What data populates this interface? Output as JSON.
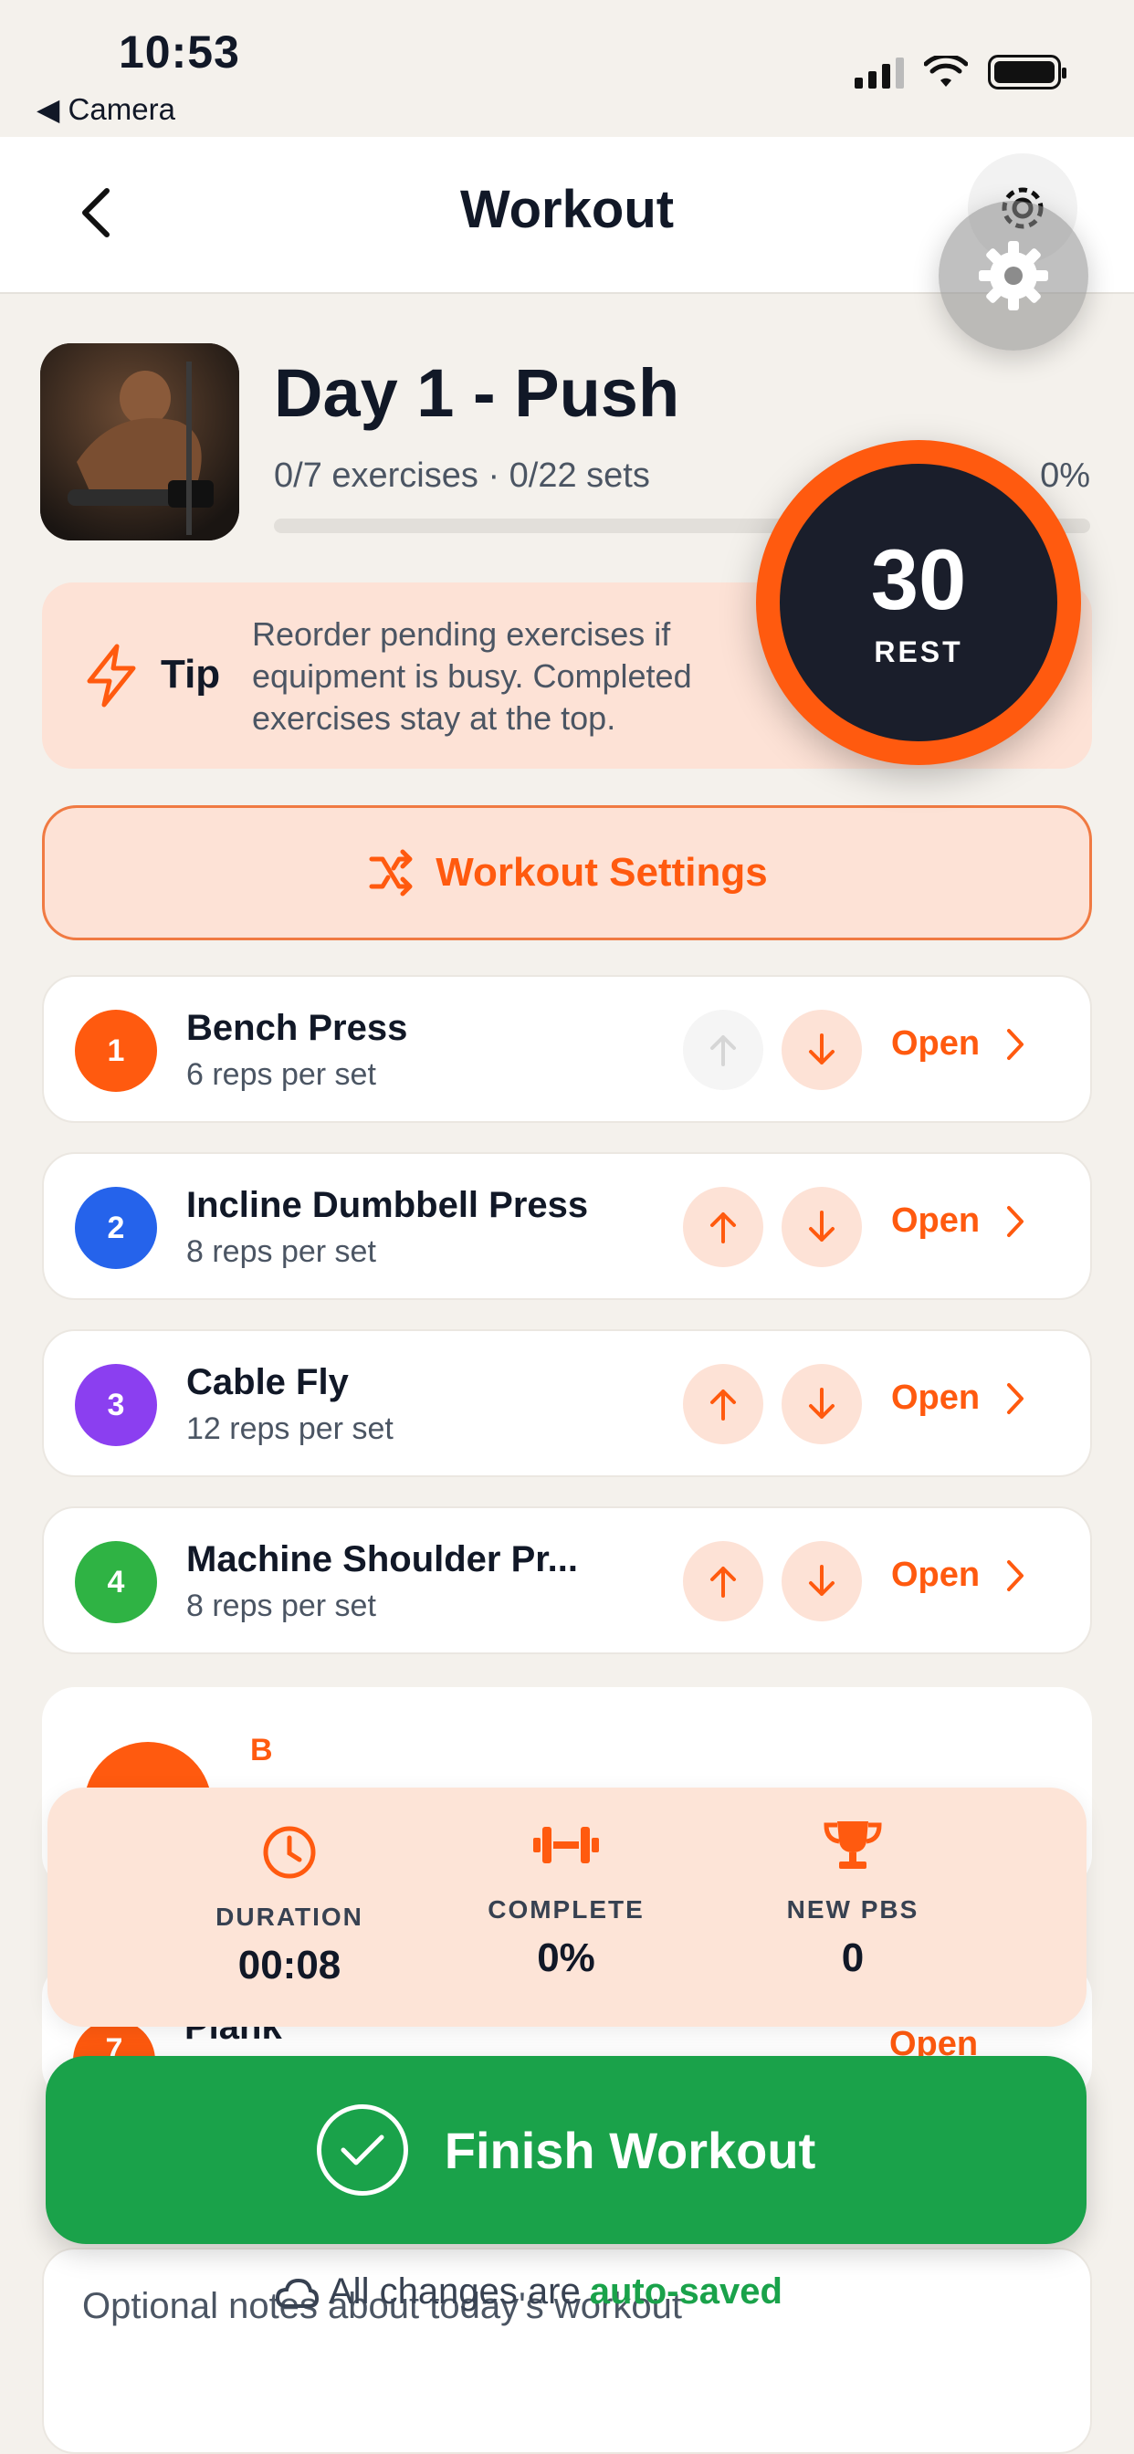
{
  "status_bar": {
    "time": "10:53",
    "back_app": "◀ Camera"
  },
  "nav": {
    "title": "Workout",
    "back_icon": "chevron-left-icon",
    "settings_icon": "gear-icon"
  },
  "workout": {
    "title": "Day 1 - Push",
    "meta": "0/7 exercises · 0/22 sets",
    "progress_pct": "0%",
    "progress_value": 0
  },
  "rest_timer": {
    "seconds": "30",
    "label": "REST"
  },
  "tip": {
    "label": "Tip",
    "text": "Reorder pending exercises if equipment is busy. Completed exercises stay at the top."
  },
  "settings_button": {
    "label": "Workout Settings",
    "icon": "shuffle-icon"
  },
  "exercises": [
    {
      "number": "1",
      "name": "Bench Press",
      "sub": "6 reps per set",
      "open": "Open",
      "color": "#ff5a0f"
    },
    {
      "number": "2",
      "name": "Incline Dumbbell Press",
      "sub": "8 reps per set",
      "open": "Open",
      "color": "#2563eb"
    },
    {
      "number": "3",
      "name": "Cable Fly",
      "sub": "12 reps per set",
      "open": "Open",
      "color": "#8b3ff0"
    },
    {
      "number": "4",
      "name": "Machine Shoulder Pr...",
      "sub": "8 reps per set",
      "open": "Open",
      "color": "#2fb344"
    }
  ],
  "hidden_card": {
    "letter": "B"
  },
  "stats": [
    {
      "label": "DURATION",
      "value": "00:08",
      "icon": "clock-icon"
    },
    {
      "label": "COMPLETE",
      "value": "0%",
      "icon": "dumbbell-icon"
    },
    {
      "label": "NEW PBS",
      "value": "0",
      "icon": "trophy-icon"
    }
  ],
  "plank": {
    "number": "7",
    "name": "Plank",
    "open": "Open"
  },
  "finish": {
    "label": "Finish Workout"
  },
  "notes": {
    "placeholder": "Optional notes about today's workout"
  },
  "autosave": {
    "prefix": "All changes are",
    "strong": "auto-saved"
  },
  "colors": {
    "accent": "#ff5a0f",
    "success": "#1aa24a",
    "tip_bg": "#fde2d6",
    "dark": "#1a1e2b"
  }
}
